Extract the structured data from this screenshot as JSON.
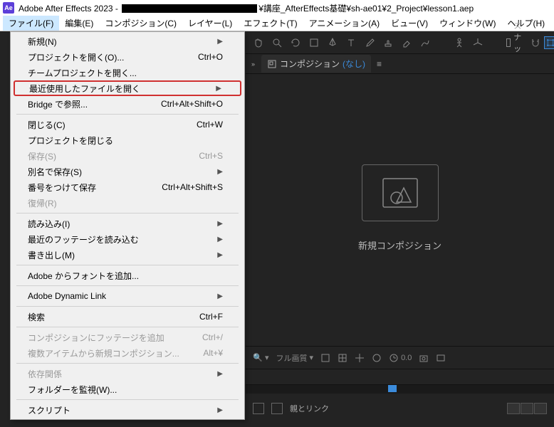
{
  "title": {
    "app_prefix": "Adobe After Effects 2023 - ",
    "path_suffix": "¥講座_AfterEffects基礎¥sh-ae01¥2_Project¥lesson1.aep",
    "icon": "Ae"
  },
  "menubar": [
    "ファイル(F)",
    "編集(E)",
    "コンポジション(C)",
    "レイヤー(L)",
    "エフェクト(T)",
    "アニメーション(A)",
    "ビュー(V)",
    "ウィンドウ(W)",
    "ヘルプ(H)"
  ],
  "file_menu": [
    {
      "label": "新規(N)",
      "shortcut": "",
      "arrow": true
    },
    {
      "label": "プロジェクトを開く(O)...",
      "shortcut": "Ctrl+O"
    },
    {
      "label": "チームプロジェクトを開く...",
      "shortcut": ""
    },
    {
      "label": "最近使用したファイルを開く",
      "shortcut": "",
      "arrow": true,
      "highlighted": true
    },
    {
      "label": "Bridge で参照...",
      "shortcut": "Ctrl+Alt+Shift+O"
    },
    {
      "sep": true
    },
    {
      "label": "閉じる(C)",
      "shortcut": "Ctrl+W"
    },
    {
      "label": "プロジェクトを閉じる",
      "shortcut": ""
    },
    {
      "label": "保存(S)",
      "shortcut": "Ctrl+S",
      "disabled": true
    },
    {
      "label": "別名で保存(S)",
      "shortcut": "",
      "arrow": true
    },
    {
      "label": "番号をつけて保存",
      "shortcut": "Ctrl+Alt+Shift+S"
    },
    {
      "label": "復帰(R)",
      "shortcut": "",
      "disabled": true
    },
    {
      "sep": true
    },
    {
      "label": "読み込み(I)",
      "shortcut": "",
      "arrow": true
    },
    {
      "label": "最近のフッテージを読み込む",
      "shortcut": "",
      "arrow": true
    },
    {
      "label": "書き出し(M)",
      "shortcut": "",
      "arrow": true
    },
    {
      "sep": true
    },
    {
      "label": "Adobe からフォントを追加...",
      "shortcut": ""
    },
    {
      "sep": true
    },
    {
      "label": "Adobe Dynamic Link",
      "shortcut": "",
      "arrow": true
    },
    {
      "sep": true
    },
    {
      "label": "検索",
      "shortcut": "Ctrl+F"
    },
    {
      "sep": true
    },
    {
      "label": "コンポジションにフッテージを追加",
      "shortcut": "Ctrl+/",
      "disabled": true
    },
    {
      "label": "複数アイテムから新規コンポジション...",
      "shortcut": "Alt+¥",
      "disabled": true
    },
    {
      "sep": true
    },
    {
      "label": "依存関係",
      "shortcut": "",
      "arrow": true,
      "disabled": true
    },
    {
      "label": "フォルダーを監視(W)...",
      "shortcut": ""
    },
    {
      "sep": true
    },
    {
      "label": "スクリプト",
      "shortcut": "",
      "arrow": true
    }
  ],
  "toolbar": {
    "snap_label": "スナップ"
  },
  "panel": {
    "tab_prefix": "コンポジション",
    "tab_name": "(なし)"
  },
  "viewer": {
    "new_comp": "新規コンポジション"
  },
  "footer": {
    "fullscreen": "フル画質",
    "zoom": "0.0"
  },
  "timeline": {
    "parent_link": "親とリンク"
  }
}
